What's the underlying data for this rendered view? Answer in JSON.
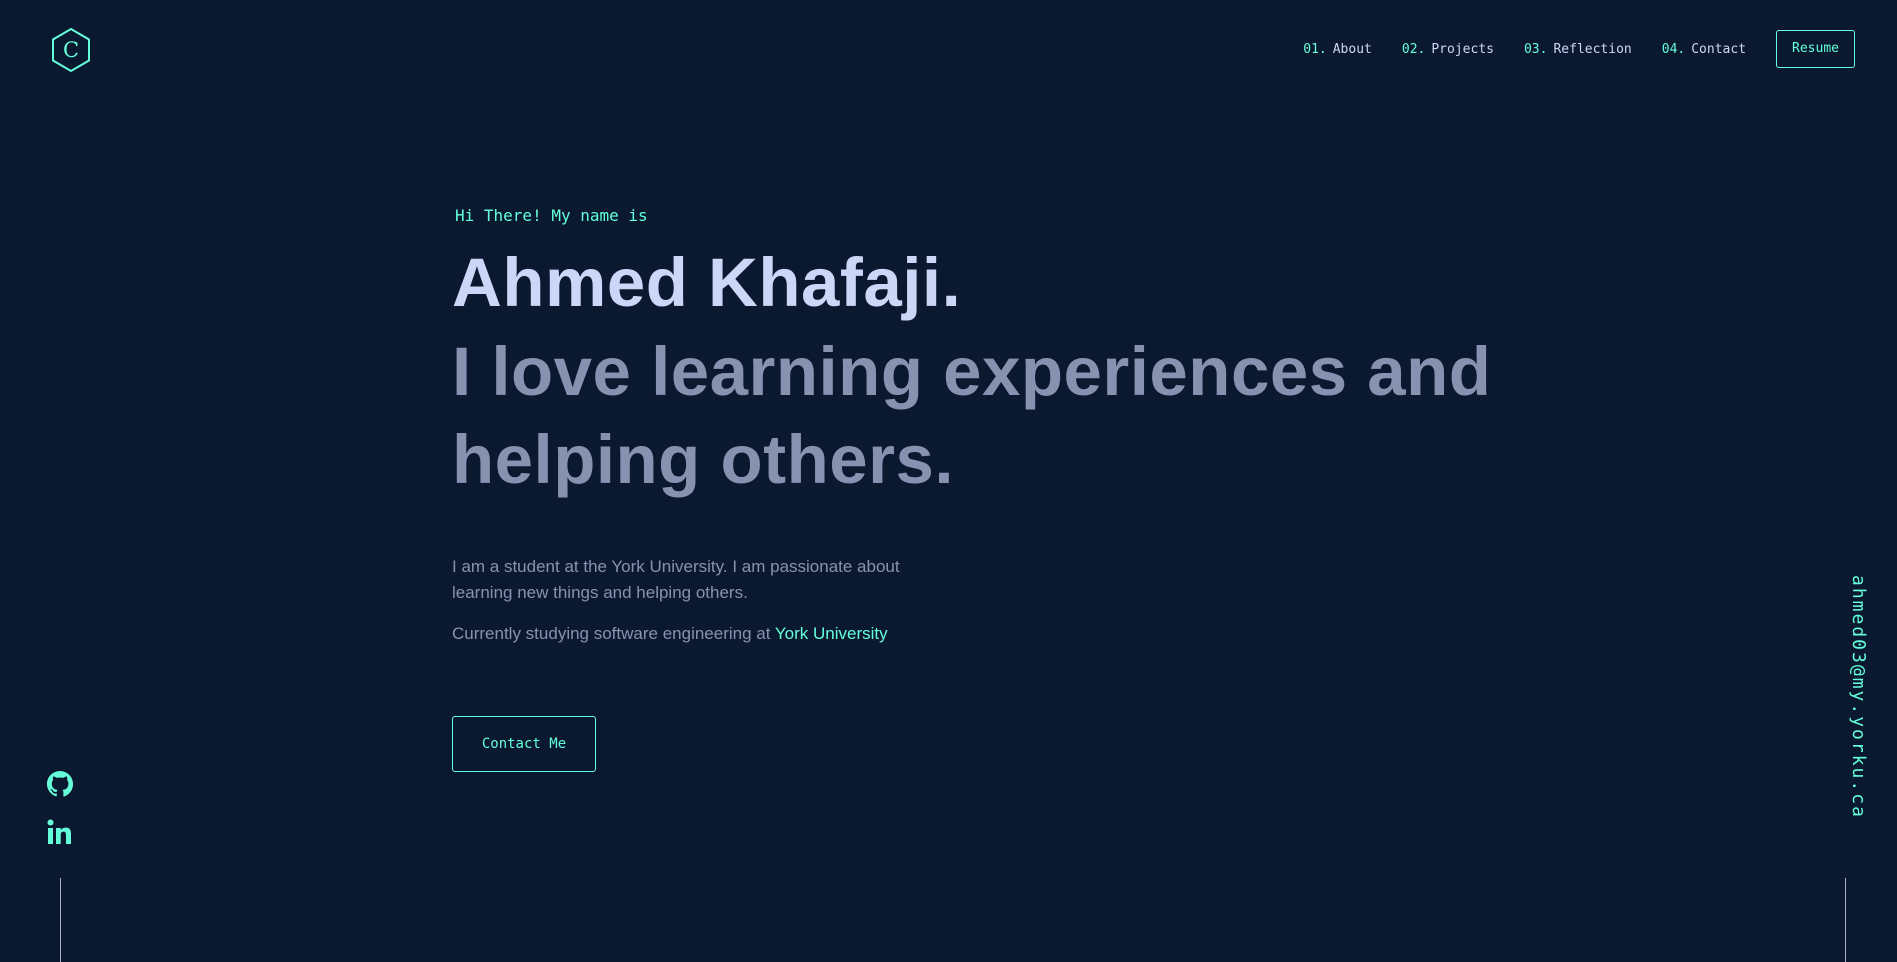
{
  "logo": {
    "letter": "C",
    "icon": "hexagon-logo-icon"
  },
  "nav": {
    "items": [
      {
        "num": "01.",
        "label": "About"
      },
      {
        "num": "02.",
        "label": "Projects"
      },
      {
        "num": "03.",
        "label": "Reflection"
      },
      {
        "num": "04.",
        "label": "Contact"
      }
    ],
    "resume_label": "Resume"
  },
  "hero": {
    "greeting": "Hi There! My name is",
    "name": "Ahmed Khafaji.",
    "tagline": "I love learning experiences and helping others.",
    "bio": "I am a student at the York University. I am passionate about learning new things and helping others.",
    "study_prefix": "Currently studying software engineering at ",
    "study_link": "York University",
    "contact_label": "Contact Me"
  },
  "social": {
    "icons": [
      "github-icon",
      "linkedin-icon"
    ]
  },
  "email": "ahmed03@my.yorku.ca",
  "colors": {
    "background": "#0b1930",
    "accent": "#64ffda",
    "heading": "#ccd6f6",
    "text": "#8892b0"
  }
}
